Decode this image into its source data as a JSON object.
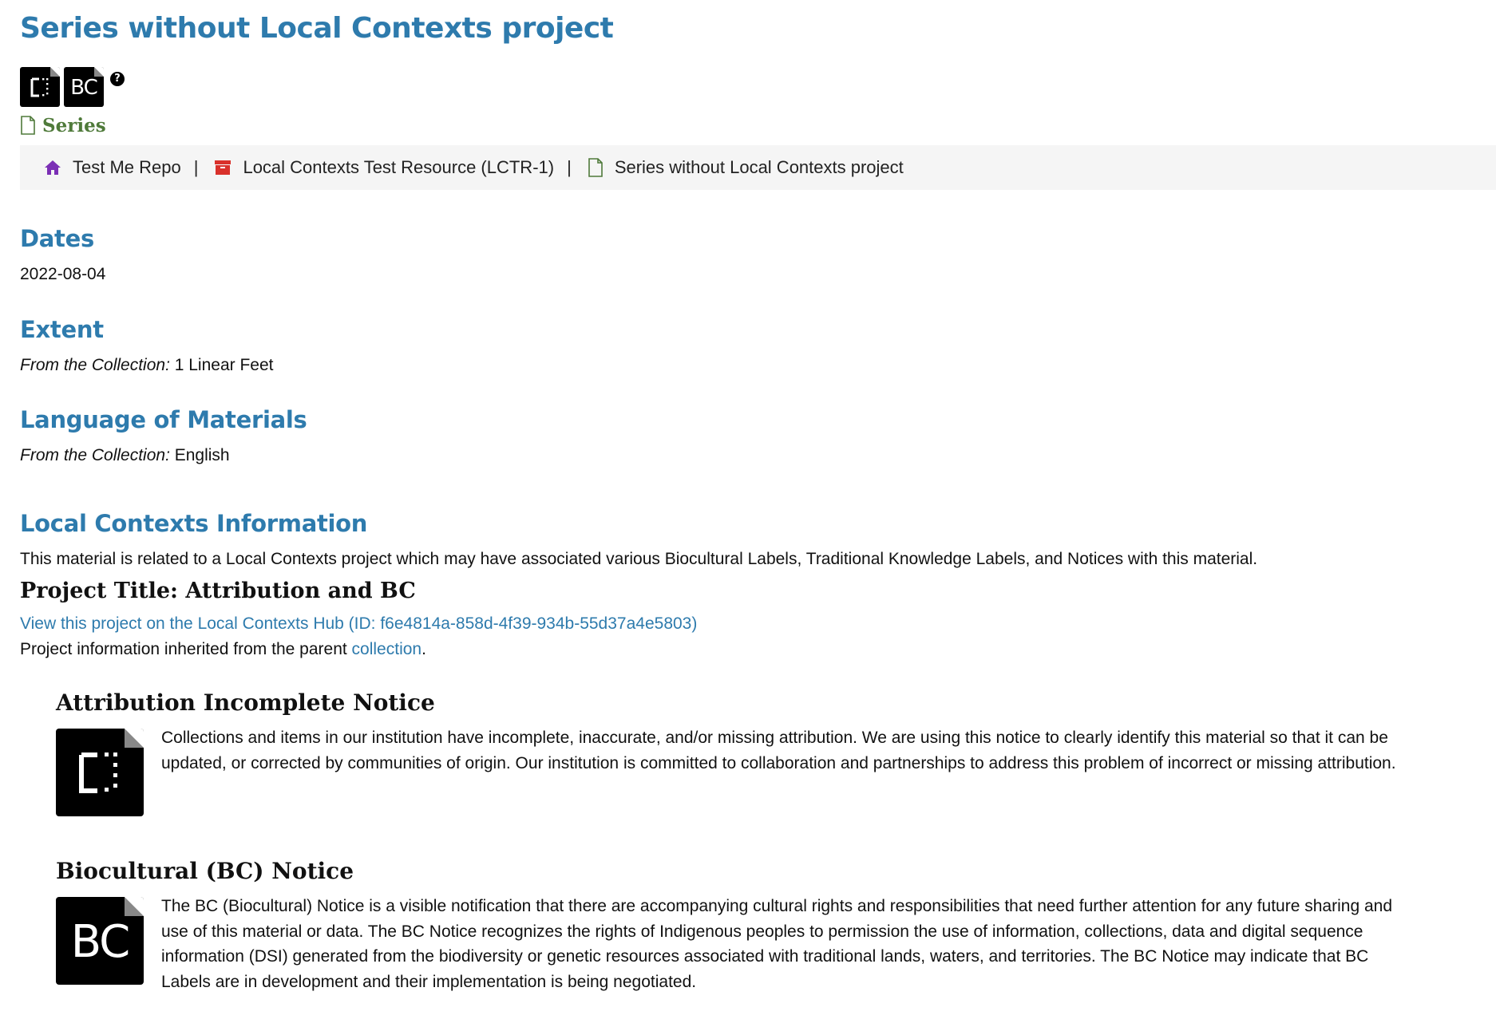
{
  "page_title": "Series without Local Contexts project",
  "badges": [
    {
      "icon": "attribution-incomplete-icon"
    },
    {
      "icon": "bc-notice-icon",
      "text": "BC"
    }
  ],
  "help": "?",
  "level": {
    "icon": "file-icon",
    "label": "Series"
  },
  "breadcrumb": [
    {
      "icon": "home-icon",
      "label": "Test Me Repo",
      "color": "#7b2fb5"
    },
    {
      "icon": "archive-box-icon",
      "label": "Local Contexts Test Resource (LCTR-1)",
      "color": "#d9312b"
    },
    {
      "icon": "file-icon",
      "label": "Series without Local Contexts project",
      "color": "#4f7a3a"
    }
  ],
  "breadcrumb_separator": "|",
  "dates": {
    "heading": "Dates",
    "value": "2022-08-04"
  },
  "extent": {
    "heading": "Extent",
    "prefix": "From the Collection:",
    "value": " 1 Linear Feet"
  },
  "language": {
    "heading": "Language of Materials",
    "prefix": "From the Collection:",
    "value": " English"
  },
  "local_contexts": {
    "heading": "Local Contexts Information",
    "description": "This material is related to a Local Contexts project which may have associated various Biocultural Labels, Traditional Knowledge Labels, and Notices with this material.",
    "project_title": "Project Title: Attribution and BC",
    "hub_link": "View this project on the Local Contexts Hub (ID: f6e4814a-858d-4f39-934b-55d37a4e5803)",
    "inherited_prefix": "Project information inherited from the parent ",
    "inherited_link": "collection",
    "inherited_suffix": ".",
    "notices": [
      {
        "title": "Attribution Incomplete Notice",
        "icon": "attribution-incomplete-icon",
        "text": "Collections and items in our institution have incomplete, inaccurate, and/or missing attribution. We are using this notice to clearly identify this material so that it can be updated, or corrected by communities of origin. Our institution is committed to collaboration and partnerships to address this problem of incorrect or missing attribution."
      },
      {
        "title": "Biocultural (BC) Notice",
        "icon": "bc-notice-icon",
        "icon_text": "BC",
        "text": "The BC (Biocultural) Notice is a visible notification that there are accompanying cultural rights and responsibilities that need further attention for any future sharing and use of this material or data. The BC Notice recognizes the rights of Indigenous peoples to permission the use of information, collections, data and digital sequence information (DSI) generated from the biodiversity or genetic resources associated with traditional lands, waters, and territories. The BC Notice may indicate that BC Labels are in development and their implementation is being negotiated."
      }
    ]
  }
}
